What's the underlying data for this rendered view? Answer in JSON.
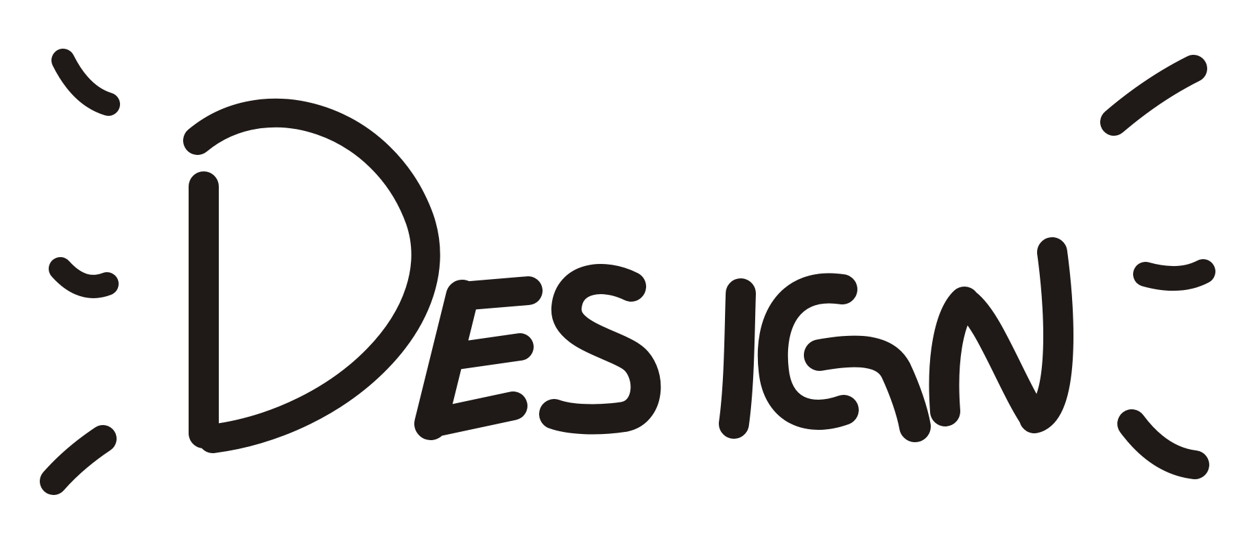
{
  "artwork": {
    "word": "DESIGN",
    "ink_color": "#1f1a18",
    "background_color": "#ffffff",
    "style": "hand-lettered marker"
  }
}
